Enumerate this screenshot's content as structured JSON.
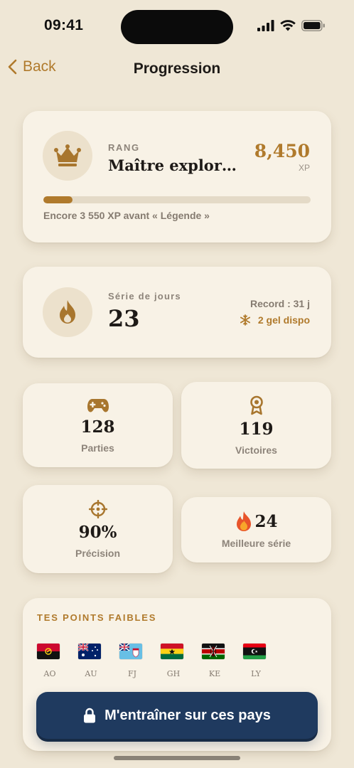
{
  "status_bar": {
    "time": "09:41"
  },
  "nav": {
    "back_label": "Back",
    "title": "Progression"
  },
  "rank": {
    "label": "RANG",
    "value": "Maître explor…",
    "xp": "8,450",
    "xp_unit": "XP",
    "progress_fraction": 0.11,
    "progress_text": "Encore 3 550 XP avant « Légende »"
  },
  "streak": {
    "label": "Série de jours",
    "value": "23",
    "record": "Record : 31 j",
    "freeze": "2 gel dispo"
  },
  "stats": [
    {
      "icon": "gamepad-icon",
      "value": "128",
      "label": "Parties"
    },
    {
      "icon": "medal-icon",
      "value": "119",
      "label": "Victoires"
    },
    {
      "icon": "target-icon",
      "value": "90%",
      "label": "Précision"
    },
    {
      "icon": "fire-emoji-icon",
      "value": "24",
      "label": "Meilleure série"
    }
  ],
  "weak_points": {
    "title": "TES POINTS FAIBLES",
    "countries": [
      {
        "code": "AO"
      },
      {
        "code": "AU"
      },
      {
        "code": "FJ"
      },
      {
        "code": "GH"
      },
      {
        "code": "KE"
      },
      {
        "code": "LY"
      }
    ],
    "cta_label": "M'entraîner sur ces pays"
  },
  "colors": {
    "background": "#efe7d6",
    "card": "#f8f2e6",
    "accent": "#b07a2c",
    "cta": "#1f3a5f"
  }
}
